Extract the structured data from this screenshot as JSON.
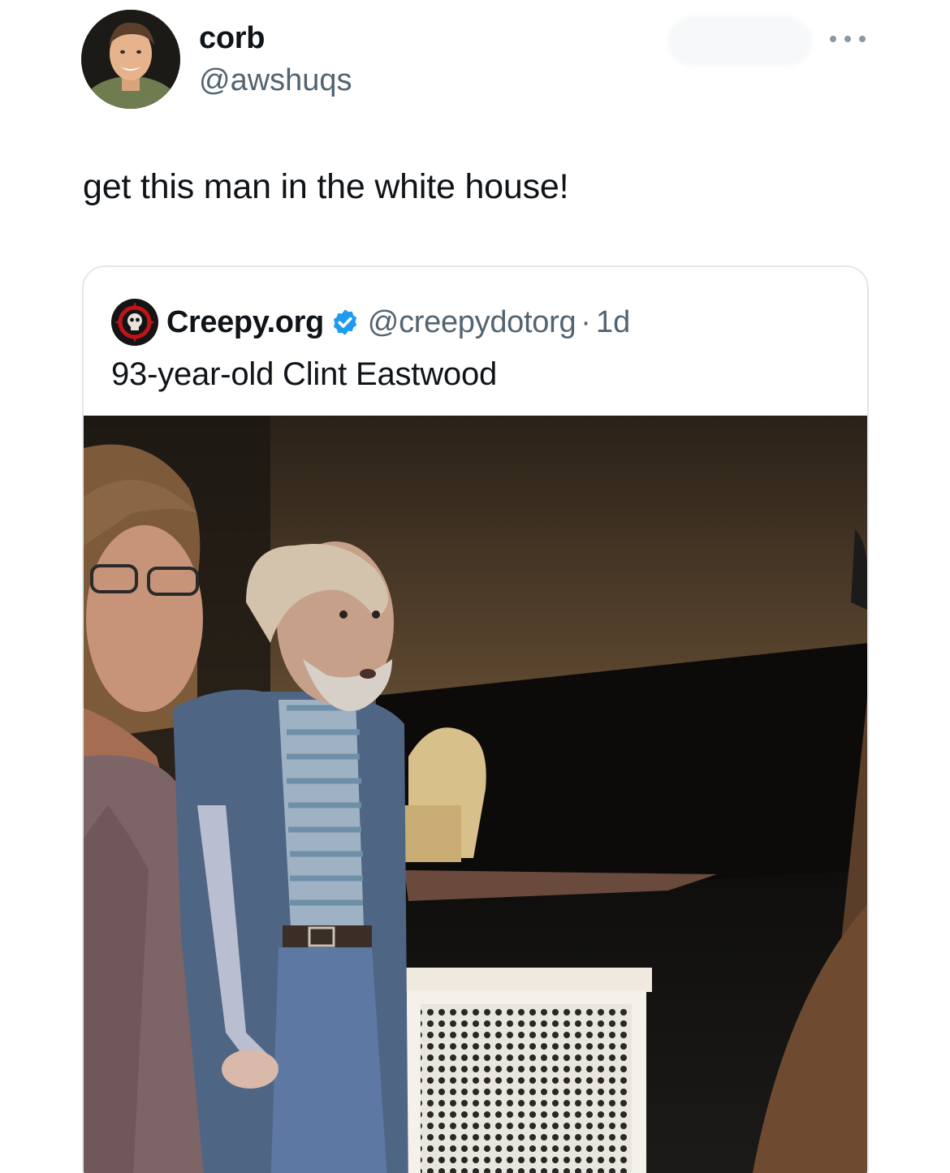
{
  "tweet": {
    "display_name": "corb",
    "handle": "@awshuqs",
    "text": "get this man in the white house!",
    "avatar_icon": "profile-photo"
  },
  "quoted_tweet": {
    "display_name": "Creepy.org",
    "handle": "@creepydotorg",
    "separator": "·",
    "time": "1d",
    "text": "93-year-old Clint Eastwood",
    "verified": true,
    "verified_color": "#1d9bf0",
    "avatar_icon": "creepy-org-logo",
    "media_icon": "photo"
  },
  "icons": {
    "more": "more-horizontal-icon",
    "verified": "verified-badge-icon"
  }
}
